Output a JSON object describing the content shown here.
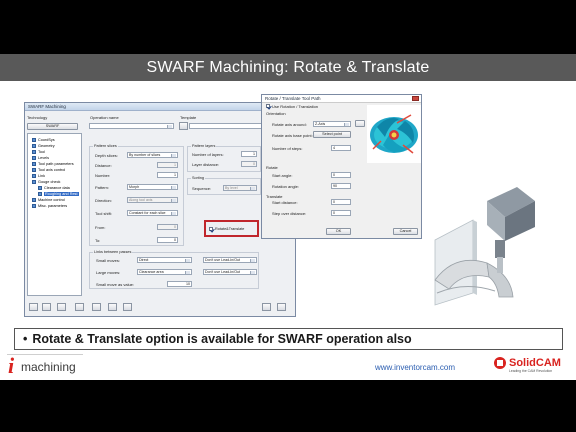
{
  "slide": {
    "title": "SWARF Machining: Rotate & Translate",
    "bullet": "Rotate & Translate option is available for SWARF operation also",
    "website": "www.inventorcam.com"
  },
  "swarf_dialog": {
    "window_title": "SWARF Machining",
    "technology_label": "Technology",
    "technology_value": "SWARF",
    "operation_name_label": "Operation name",
    "template_label": "Template",
    "tree": [
      {
        "label": "CoordSys"
      },
      {
        "label": "Geometry"
      },
      {
        "label": "Tool"
      },
      {
        "label": "Levels"
      },
      {
        "label": "Tool path parameters"
      },
      {
        "label": "Tool axis control"
      },
      {
        "label": "Link"
      },
      {
        "label": "Gouge check"
      },
      {
        "label": "Clearance data"
      },
      {
        "label": "Roughing and Rest",
        "selected": true
      },
      {
        "label": "Machine control"
      },
      {
        "label": "Misc. parameters"
      }
    ],
    "pattern_slices": {
      "group": "Pattern slices",
      "depth_slices_label": "Depth slices:",
      "depth_slices_value": "By number of slices",
      "distance_label": "Distance:",
      "distance_value": "1",
      "number_label": "Number:",
      "number_value": "1",
      "pattern_label": "Pattern:",
      "pattern_value": "Morph",
      "direction_label": "Direction:",
      "direction_value": "Along tool axis",
      "tool_shift_label": "Tool shift:",
      "tool_shift_value": "Constant for each slice",
      "from_label": "From:",
      "from_value": "0",
      "to_label": "To:",
      "to_value": "0"
    },
    "pattern_layers": {
      "group": "Pattern layers",
      "number_of_layers_label": "Number of layers:",
      "number_of_layers_value": "1",
      "layer_distance_label": "Layer distance:",
      "layer_distance_value": "0"
    },
    "sorting": {
      "group": "Sorting",
      "sequence_label": "Sequence:",
      "sequence_value": "By level"
    },
    "rotate_translate_label": "Rotate&Translate",
    "links": {
      "group": "Links between passes",
      "small_moves_label": "Small moves:",
      "small_moves_value": "Direct",
      "large_moves_label": "Large moves:",
      "large_moves_value": "Clearance area",
      "small_move_label": "Small move as value:",
      "small_move_value": "10",
      "lead_in_small": "Don't use Lead-In/Out",
      "lead_in_large": "Don't use Lead-In/Out"
    }
  },
  "rotate_dialog": {
    "window_title": "Rotate / Translate Tool Path",
    "use_checkbox_label": "Use Rotation / Translation",
    "orientation_label": "Orientation",
    "rotate_axis_label": "Rotate axis around:",
    "rotate_axis_value": "Z-Axis",
    "rotate_point_label": "Rotate axis base point:",
    "select_point_button": "Select point",
    "number_of_steps_label": "Number of steps:",
    "number_of_steps_value": "4",
    "rotate_group": "Rotate",
    "start_angle_label": "Start angle:",
    "start_angle_value": "0",
    "rotation_angle_label": "Rotation angle:",
    "rotation_angle_value": "90",
    "translate_group": "Translate",
    "start_distance_label": "Start distance:",
    "start_distance_value": "0",
    "step_distance_label": "Step over distance:",
    "step_distance_value": "0",
    "ok_button": "OK",
    "cancel_button": "Cancel"
  },
  "logos": {
    "imachining_i": "i",
    "imachining_text": "machining",
    "solidcam_text": "SolidCAM",
    "solidcam_tagline": "Leading the CAM Revolution"
  },
  "colors": {
    "title_bar": "#595959",
    "highlight_box": "#c0262c",
    "link": "#2a5db0",
    "solidcam_red": "#d9231f"
  }
}
